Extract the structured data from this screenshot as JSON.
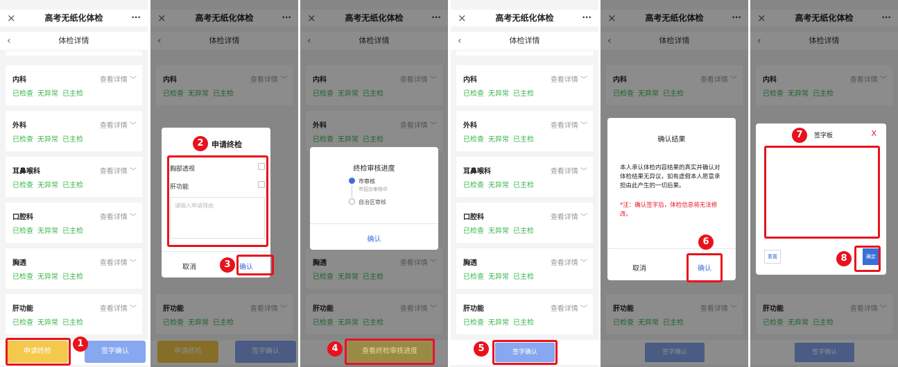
{
  "app": {
    "title": "高考无纸化体检",
    "subtitle": "体检详情",
    "close_glyph": "×",
    "back_glyph": "‹",
    "more_glyph": "···"
  },
  "cards": [
    {
      "name": "内科",
      "view": "查看详情",
      "tags": [
        "已检查",
        "无异常",
        "已主检"
      ]
    },
    {
      "name": "外科",
      "view": "查看详情",
      "tags": [
        "已检查",
        "无异常",
        "已主检"
      ]
    },
    {
      "name": "耳鼻喉科",
      "view": "查看详情",
      "tags": [
        "已检查",
        "无异常",
        "已主检"
      ]
    },
    {
      "name": "口腔科",
      "view": "查看详情",
      "tags": [
        "已检查",
        "无异常",
        "已主检"
      ]
    },
    {
      "name": "胸透",
      "view": "查看详情",
      "tags": [
        "已检查",
        "无异常",
        "已主检"
      ]
    },
    {
      "name": "肝功能",
      "view": "查看详情",
      "tags": [
        "已检查",
        "无异常",
        "已主检"
      ]
    }
  ],
  "bottom": {
    "apply": "申请终检",
    "sign": "签字确认",
    "view_progress": "查看终检审核进度"
  },
  "apply_dialog": {
    "title": "申请终检",
    "items": [
      "胸部透视",
      "肝功能"
    ],
    "placeholder": "请输入申请理由",
    "cancel": "取消",
    "confirm": "确认"
  },
  "progress_dialog": {
    "title": "终检审核进度",
    "step1": "市审核",
    "step1_status": "市招办审核中",
    "step2": "自治区审核",
    "confirm": "确认"
  },
  "result_dialog": {
    "title": "确认结果",
    "body": "本人承认体检内容结果的真实并确认对体检结果无异议，如有虚假本人愿意承担由此产生的一切后果。",
    "note": "*注：确认签字后，体检信息将无法修改。",
    "cancel": "取消",
    "confirm": "确认"
  },
  "sign_dialog": {
    "title": "签字板",
    "close": "X",
    "reset": "重置",
    "ok": "确定"
  },
  "badges": [
    "1",
    "2",
    "3",
    "4",
    "5",
    "6",
    "7",
    "8"
  ],
  "colors": {
    "accent_red": "#e8121c",
    "green": "#39b54a",
    "apply_yellow": "#f4c84a",
    "sign_blue": "#87a7f0",
    "link_blue": "#3a6fd8"
  }
}
